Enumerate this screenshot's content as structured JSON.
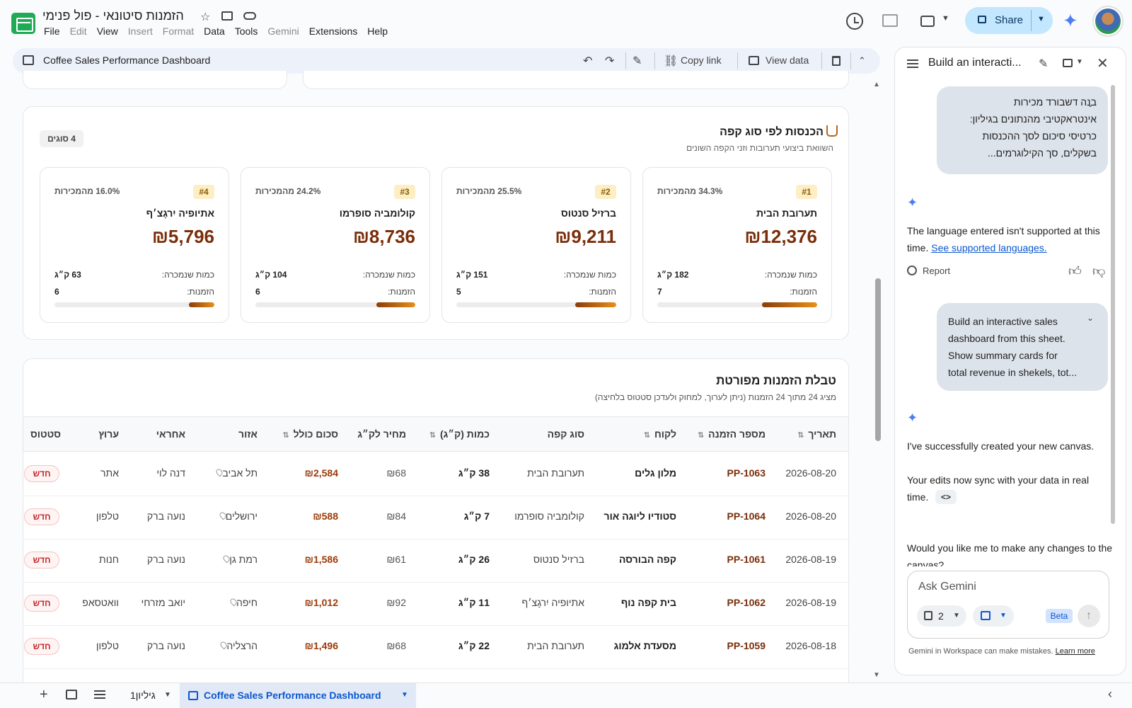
{
  "app": {
    "doc_title": "הזמנות סיטונאי - פול פנימי",
    "menu": [
      {
        "label": "File",
        "enabled": true
      },
      {
        "label": "Edit",
        "enabled": false
      },
      {
        "label": "View",
        "enabled": true
      },
      {
        "label": "Insert",
        "enabled": false
      },
      {
        "label": "Format",
        "enabled": false
      },
      {
        "label": "Data",
        "enabled": true
      },
      {
        "label": "Tools",
        "enabled": true
      },
      {
        "label": "Gemini",
        "enabled": false
      },
      {
        "label": "Extensions",
        "enabled": true
      },
      {
        "label": "Help",
        "enabled": true
      }
    ],
    "share_label": "Share",
    "colors": {
      "brand_green": "#1faa55",
      "accent_blue": "#0b57d0",
      "coffee_brown": "#7a2e0a",
      "status_red": "#c62828"
    }
  },
  "toolbar": {
    "title": "Coffee Sales Performance Dashboard",
    "copy_link": "Copy link",
    "view_data": "View data",
    "icons": [
      "undo-icon",
      "redo-icon",
      "edit-icon",
      "link-icon",
      "table-icon",
      "trash-icon",
      "chevron-up-icon"
    ]
  },
  "revenue": {
    "title": "הכנסות לפי סוג קפה",
    "subtitle": "השוואת ביצועי תערובות וזני הקפה השונים",
    "badge": "4 סוגים",
    "qty_label": "כמות שנמכרה:",
    "orders_label": "הזמנות:",
    "products": [
      {
        "rank": "#1",
        "share": "34.3% מהמכירות",
        "share_value": 34.3,
        "name": "תערובת הבית",
        "revenue": "₪12,376",
        "qty": "182 ק״ג",
        "orders": "7"
      },
      {
        "rank": "#2",
        "share": "25.5% מהמכירות",
        "share_value": 25.5,
        "name": "ברזיל סנטוס",
        "revenue": "₪9,211",
        "qty": "151 ק״ג",
        "orders": "5"
      },
      {
        "rank": "#3",
        "share": "24.2% מהמכירות",
        "share_value": 24.2,
        "name": "קולומביה סופרמו",
        "revenue": "₪8,736",
        "qty": "104 ק״ג",
        "orders": "6"
      },
      {
        "rank": "#4",
        "share": "16.0% מהמכירות",
        "share_value": 16.0,
        "name": "אתיופיה יִרגָצ׳ף",
        "revenue": "₪5,796",
        "qty": "63 ק״ג",
        "orders": "6"
      }
    ]
  },
  "orders": {
    "title": "טבלת הזמנות מפורטת",
    "subtitle": "מציג 24 מתוך 24 הזמנות (ניתן לערוך, למחוק ולעדכן סטטוס בלחיצה)",
    "columns": {
      "date": "תאריך",
      "order_id": "מספר הזמנה",
      "customer": "לקוח",
      "coffee": "סוג קפה",
      "qty": "כמות (ק״ג)",
      "price": "מחיר לק״ג",
      "total": "סכום כולל",
      "region": "אזור",
      "rep": "אחראי",
      "channel": "ערוץ",
      "status": "סטטוס"
    },
    "rows": [
      {
        "date": "2026-08-20",
        "order_id": "PP-1063",
        "customer": "מלון גלים",
        "coffee": "תערובת הבית",
        "qty": "38 ק״ג",
        "price": "₪68",
        "total": "₪2,584",
        "region": "תל אביב",
        "rep": "דנה לוי",
        "channel": "אתר",
        "status": "חדש"
      },
      {
        "date": "2026-08-20",
        "order_id": "PP-1064",
        "customer": "סטודיו ליוגה אור",
        "coffee": "קולומביה סופרמו",
        "qty": "7 ק״ג",
        "price": "₪84",
        "total": "₪588",
        "region": "ירושלים",
        "rep": "נועה ברק",
        "channel": "טלפון",
        "status": "חדש"
      },
      {
        "date": "2026-08-19",
        "order_id": "PP-1061",
        "customer": "קפה הבורסה",
        "coffee": "ברזיל סנטוס",
        "qty": "26 ק״ג",
        "price": "₪61",
        "total": "₪1,586",
        "region": "רמת גן",
        "rep": "נועה ברק",
        "channel": "חנות",
        "status": "חדש"
      },
      {
        "date": "2026-08-19",
        "order_id": "PP-1062",
        "customer": "בית קפה נוף",
        "coffee": "אתיופיה יִרגָצ׳ף",
        "qty": "11 ק״ג",
        "price": "₪92",
        "total": "₪1,012",
        "region": "חיפה",
        "rep": "יואב מזרחי",
        "channel": "וואטסאפ",
        "status": "חדש"
      },
      {
        "date": "2026-08-18",
        "order_id": "PP-1059",
        "customer": "מסעדת אלמוג",
        "coffee": "תערובת הבית",
        "qty": "22 ק״ג",
        "price": "₪68",
        "total": "₪1,496",
        "region": "הרצליה",
        "rep": "נועה ברק",
        "channel": "טלפון",
        "status": "חדש"
      }
    ]
  },
  "panel": {
    "title": "Build an interacti...",
    "msg1": [
      "בנה דשבורד מכירות",
      "אינטראקטיבי מהנתונים בגיליון:",
      "כרטיסי סיכום לסך ההכנסות",
      "בשקלים, סך הקילוגרמים..."
    ],
    "resp1_text": "The language entered isn't supported at this time.",
    "resp1_link": "See supported languages.",
    "report": "Report",
    "msg2": [
      "Build an interactive sales",
      "dashboard from this sheet.",
      "Show summary cards for",
      "total revenue in shekels, tot..."
    ],
    "resp2_line1": "I've successfully created your new canvas.",
    "resp2_line2": "Your edits now sync with your data in real time.",
    "code_chip": "<>",
    "resp2_line3": "Would you like me to make any changes to the canvas?",
    "input_placeholder": "Ask Gemini",
    "source_count": "2",
    "beta": "Beta",
    "disclaimer": "Gemini in Workspace can make mistakes.",
    "learn_more": "Learn more"
  },
  "sheets": {
    "tab1": "גיליון1",
    "tab2": "Coffee Sales Performance Dashboard"
  }
}
